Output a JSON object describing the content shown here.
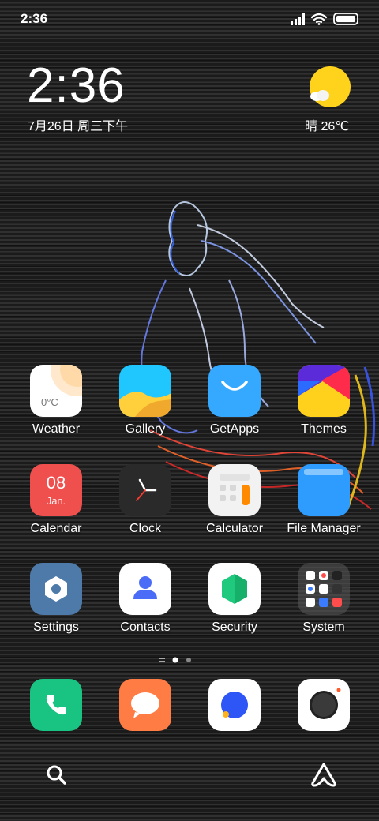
{
  "status_bar": {
    "time": "2:36"
  },
  "clock_widget": {
    "time": "2:36",
    "date": "7月26日 周三下午"
  },
  "weather_widget": {
    "text": "晴 26℃",
    "icon": "sunny-cloud-icon"
  },
  "weather_app_temp": "0°C",
  "calendar_app": {
    "day": "08",
    "month": "Jan."
  },
  "apps": [
    {
      "label": "Weather"
    },
    {
      "label": "Gallery"
    },
    {
      "label": "GetApps"
    },
    {
      "label": "Themes"
    },
    {
      "label": "Calendar"
    },
    {
      "label": "Clock"
    },
    {
      "label": "Calculator"
    },
    {
      "label": "File Manager"
    },
    {
      "label": "Settings"
    },
    {
      "label": "Contacts"
    },
    {
      "label": "Security"
    },
    {
      "label": "System"
    }
  ],
  "dock": [
    {
      "icon": "phone-icon"
    },
    {
      "icon": "messages-icon"
    },
    {
      "icon": "browser-icon"
    },
    {
      "icon": "camera-icon"
    }
  ],
  "page_indicator": {
    "current": 2,
    "count": 3
  },
  "bottom_bar": {
    "left_icon": "search-icon",
    "right_icon": "assistant-icon"
  },
  "colors": {
    "weather_sun": "#ffd21c",
    "calendar_bg": "#f0504d",
    "phone_bg": "#19c483",
    "messages_bg": "#ff7c45",
    "filemanager_bg": "#2e9bff"
  }
}
